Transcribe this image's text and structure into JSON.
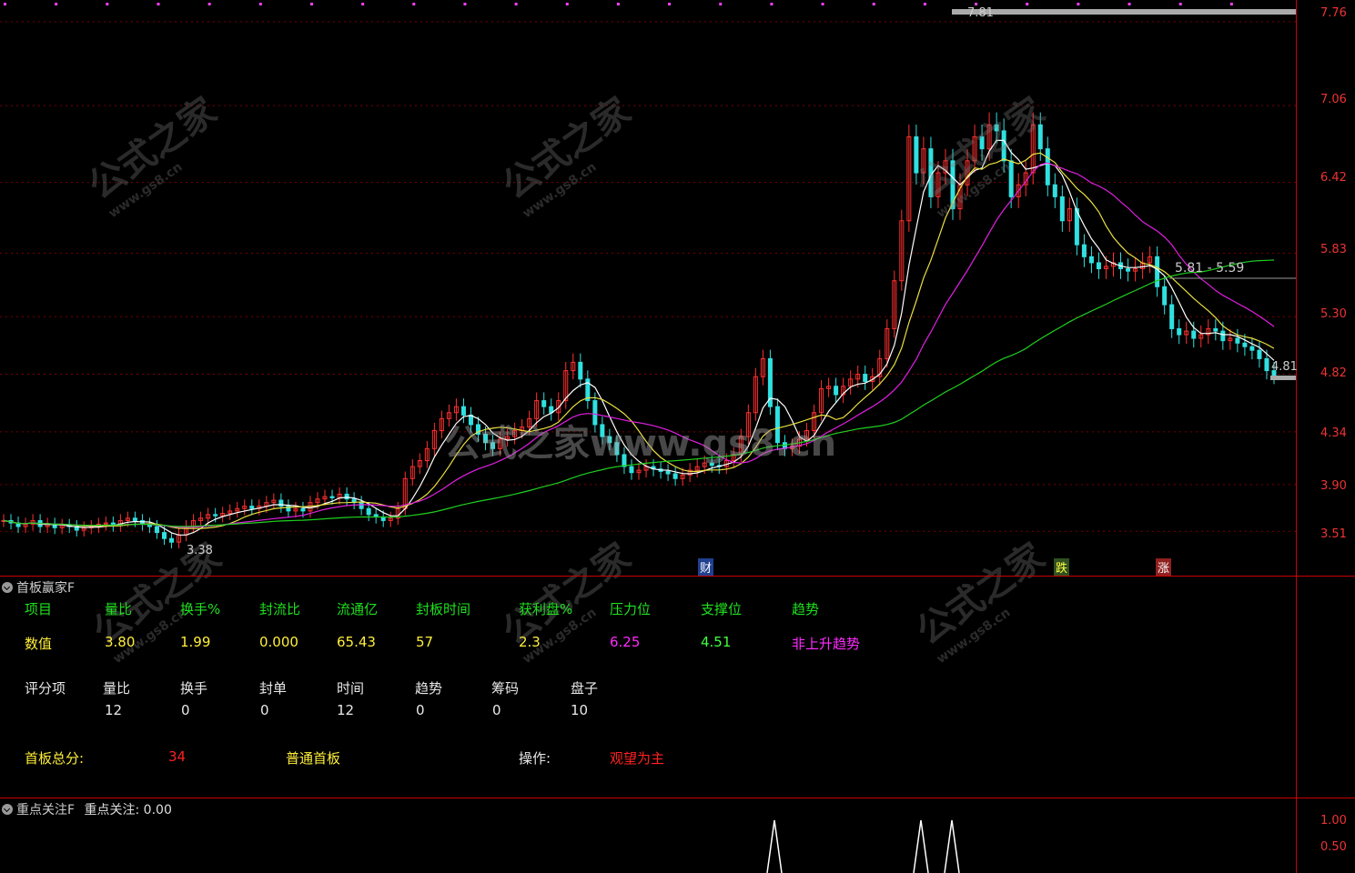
{
  "price_axis": {
    "ticks": [
      "7.76",
      "7.06",
      "6.42",
      "5.83",
      "5.30",
      "4.82",
      "4.34",
      "3.90",
      "3.51"
    ]
  },
  "chart_labels": {
    "high_label": "7.81",
    "low_label": "3.38",
    "range_label": "5.81 - 5.59",
    "last_label": "4.81"
  },
  "markers": {
    "cai": "财",
    "die": "跌",
    "zhang": "涨"
  },
  "watermark": {
    "main": "公式之家www.gs8.cn",
    "tile": "公式之家",
    "tile_sub": "www.gs8.cn"
  },
  "panel1": {
    "title": "首板赢家F",
    "headers": [
      "项目",
      "量比",
      "换手%",
      "封流比",
      "流通亿",
      "封板时间",
      "获利盘%",
      "压力位",
      "支撑位",
      "趋势"
    ],
    "values": [
      "数值",
      "3.80",
      "1.99",
      "0.000",
      "65.43",
      "57",
      "2.3",
      "6.25",
      "4.51",
      "非上升趋势"
    ],
    "score_headers": [
      "评分项",
      "量比",
      "换手",
      "封单",
      "时间",
      "趋势",
      "筹码",
      "盘子"
    ],
    "score_values": [
      "12",
      "0",
      "0",
      "12",
      "0",
      "0",
      "10"
    ],
    "total_label": "首板总分:",
    "total_value": "34",
    "board_type": "普通首板",
    "op_label": "操作:",
    "op_value": "观望为主"
  },
  "panel2": {
    "title": "重点关注F",
    "value_label": "重点关注: 0.00",
    "ticks": [
      "1.00",
      "0.50"
    ]
  },
  "colors": {
    "up": "#ff3030",
    "down": "#30e0e0",
    "ma_white": "#ffffff",
    "ma_yellow": "#e8e040",
    "ma_magenta": "#e020e0",
    "ma_green": "#20d020",
    "axis": "#cc0000"
  },
  "chart_data": {
    "type": "candlestick",
    "ylim": [
      3.3,
      7.85
    ],
    "closes": [
      3.6,
      3.58,
      3.55,
      3.57,
      3.6,
      3.55,
      3.57,
      3.54,
      3.56,
      3.55,
      3.52,
      3.54,
      3.55,
      3.57,
      3.58,
      3.56,
      3.6,
      3.62,
      3.6,
      3.57,
      3.55,
      3.5,
      3.45,
      3.42,
      3.48,
      3.55,
      3.6,
      3.62,
      3.65,
      3.64,
      3.66,
      3.68,
      3.7,
      3.72,
      3.7,
      3.72,
      3.75,
      3.77,
      3.72,
      3.68,
      3.7,
      3.68,
      3.75,
      3.78,
      3.8,
      3.79,
      3.82,
      3.78,
      3.75,
      3.7,
      3.65,
      3.63,
      3.6,
      3.62,
      3.7,
      3.95,
      4.05,
      4.1,
      4.2,
      4.35,
      4.45,
      4.5,
      4.55,
      4.48,
      4.4,
      4.32,
      4.25,
      4.2,
      4.28,
      4.3,
      4.35,
      4.38,
      4.45,
      4.6,
      4.55,
      4.5,
      4.6,
      4.85,
      4.92,
      4.78,
      4.6,
      4.4,
      4.3,
      4.25,
      4.15,
      4.05,
      4.0,
      4.02,
      4.05,
      4.03,
      4.01,
      3.99,
      3.95,
      3.98,
      4.02,
      4.05,
      4.08,
      4.06,
      4.05,
      4.1,
      4.15,
      4.3,
      4.5,
      4.8,
      4.95,
      4.55,
      4.25,
      4.2,
      4.22,
      4.28,
      4.35,
      4.5,
      4.7,
      4.72,
      4.65,
      4.72,
      4.78,
      4.82,
      4.76,
      4.8,
      4.95,
      5.2,
      5.6,
      6.1,
      6.8,
      6.5,
      6.7,
      6.3,
      6.5,
      6.6,
      6.2,
      6.4,
      6.6,
      6.8,
      6.7,
      6.9,
      6.85,
      6.6,
      6.3,
      6.4,
      6.5,
      6.9,
      6.7,
      6.4,
      6.3,
      6.1,
      6.2,
      5.9,
      5.8,
      5.75,
      5.7,
      5.72,
      5.75,
      5.7,
      5.68,
      5.7,
      5.75,
      5.8,
      5.55,
      5.4,
      5.2,
      5.15,
      5.18,
      5.12,
      5.15,
      5.2,
      5.18,
      5.1,
      5.12,
      5.08,
      5.05,
      5.02,
      4.95,
      4.85,
      4.81
    ]
  }
}
